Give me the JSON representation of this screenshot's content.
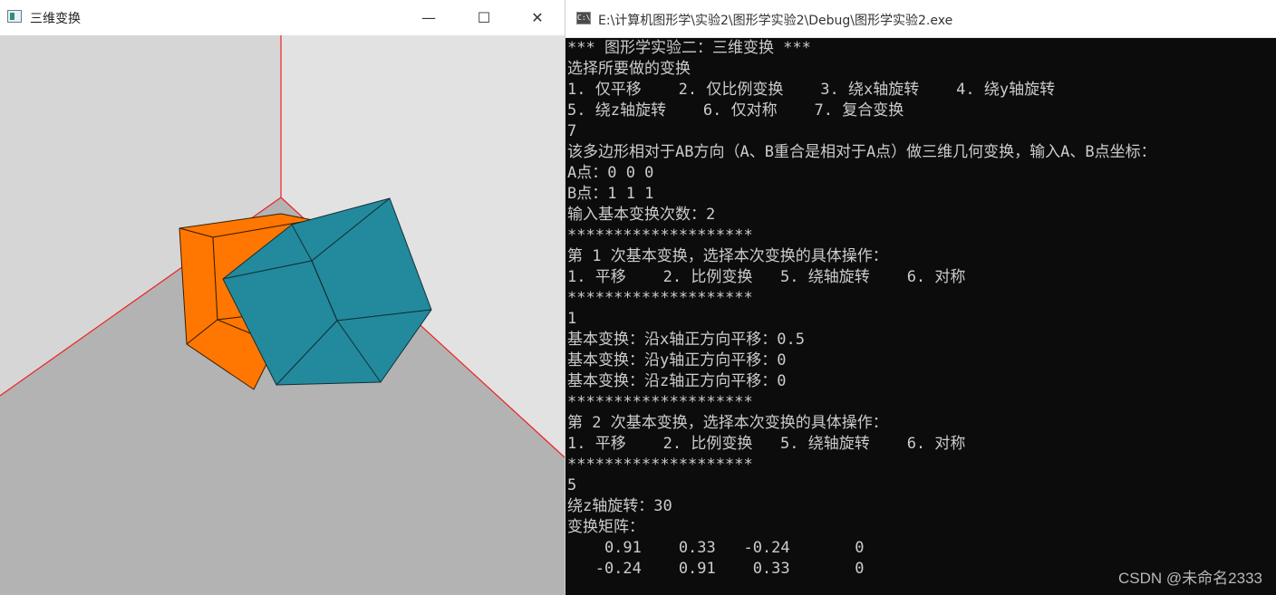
{
  "gl_window": {
    "title": "三维变换",
    "minimize": "—",
    "maximize": "☐",
    "close": "✕"
  },
  "console": {
    "title": "E:\\计算机图形学\\实验2\\图形学实验2\\Debug\\图形学实验2.exe",
    "icon_text": "C:\\",
    "lines": [
      "*** 图形学实验二：三维变换 ***",
      "选择所要做的变换",
      "1. 仅平移    2. 仅比例变换    3. 绕x轴旋转    4. 绕y轴旋转",
      "5. 绕z轴旋转    6. 仅对称    7. 复合变换",
      "7",
      "该多边形相对于AB方向（A、B重合是相对于A点）做三维几何变换，输入A、B点坐标：",
      "A点：0 0 0",
      "B点：1 1 1",
      "输入基本变换次数：2",
      "********************",
      "第 1 次基本变换，选择本次变换的具体操作：",
      "1. 平移    2. 比例变换   5. 绕轴旋转    6. 对称",
      "********************",
      "1",
      "基本变换：沿x轴正方向平移：0.5",
      "基本变换：沿y轴正方向平移：0",
      "基本变换：沿z轴正方向平移：0",
      "********************",
      "第 2 次基本变换，选择本次变换的具体操作：",
      "1. 平移    2. 比例变换   5. 绕轴旋转    6. 对称",
      "********************",
      "5",
      "绕z轴旋转：30",
      "变换矩阵：",
      "    0.91    0.33   -0.24       0",
      "   -0.24    0.91    0.33       0"
    ]
  },
  "watermark": "CSDN @未命名2333",
  "colors": {
    "orange_cube": "#ff7700",
    "teal_cube": "#228a9c",
    "axis": "#ee2222",
    "back_wall": "#e2e2e2",
    "left_wall": "#d6d6d6",
    "floor": "#b3b3b3"
  }
}
